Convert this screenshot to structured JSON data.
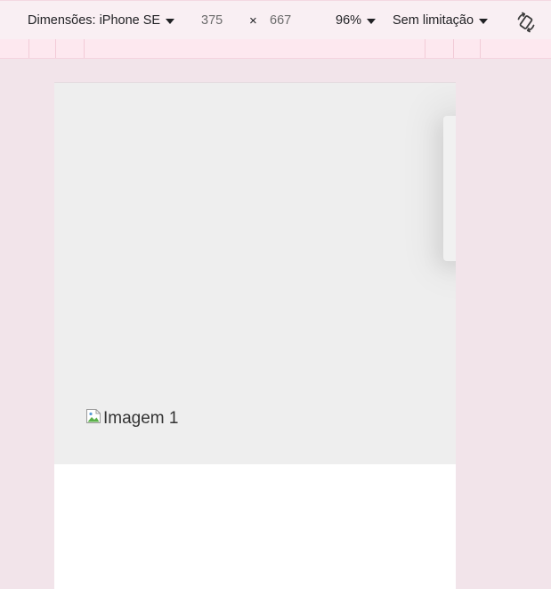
{
  "toolbar": {
    "dimensions_label": "Dimensões: iPhone SE",
    "width_value": "375",
    "times_symbol": "×",
    "height_value": "667",
    "zoom_label": "96%",
    "throttle_label": "Sem limitação",
    "rotate_icon": "rotate-icon"
  },
  "viewport": {
    "image_alt": "Imagem 1",
    "broken_image_icon": "broken-image-icon"
  },
  "colors": {
    "toolbar_bg": "#f9eff3",
    "ruler_bg": "#fde8ef",
    "page_bg": "#f2e4ea",
    "hero_bg": "#eeeeee"
  }
}
